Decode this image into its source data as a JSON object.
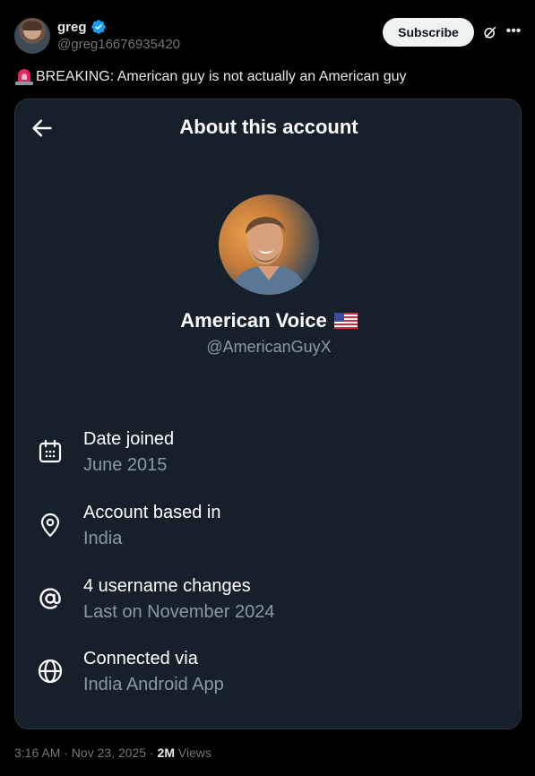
{
  "post": {
    "author_name": "greg",
    "author_handle": "@greg16676935420",
    "subscribe_label": "Subscribe",
    "text": "BREAKING: American guy is not actually an American guy",
    "timestamp": "3:16 AM · Nov 23, 2025 · ",
    "views_count": "2M",
    "views_label": " Views"
  },
  "card": {
    "title": "About this account",
    "display_name": "American Voice",
    "handle": "@AmericanGuyX",
    "items": [
      {
        "icon": "calendar-icon",
        "label": "Date joined",
        "value": "June 2015"
      },
      {
        "icon": "location-pin-icon",
        "label": "Account based in",
        "value": "India"
      },
      {
        "icon": "at-sign-icon",
        "label": "4 username changes",
        "value": "Last on November 2024"
      },
      {
        "icon": "globe-icon",
        "label": "Connected via",
        "value": "India Android App"
      }
    ]
  },
  "colors": {
    "background": "#000000",
    "card_background": "#15202b",
    "verified_blue": "#1d9bf0",
    "muted_text": "#8b98a5"
  }
}
